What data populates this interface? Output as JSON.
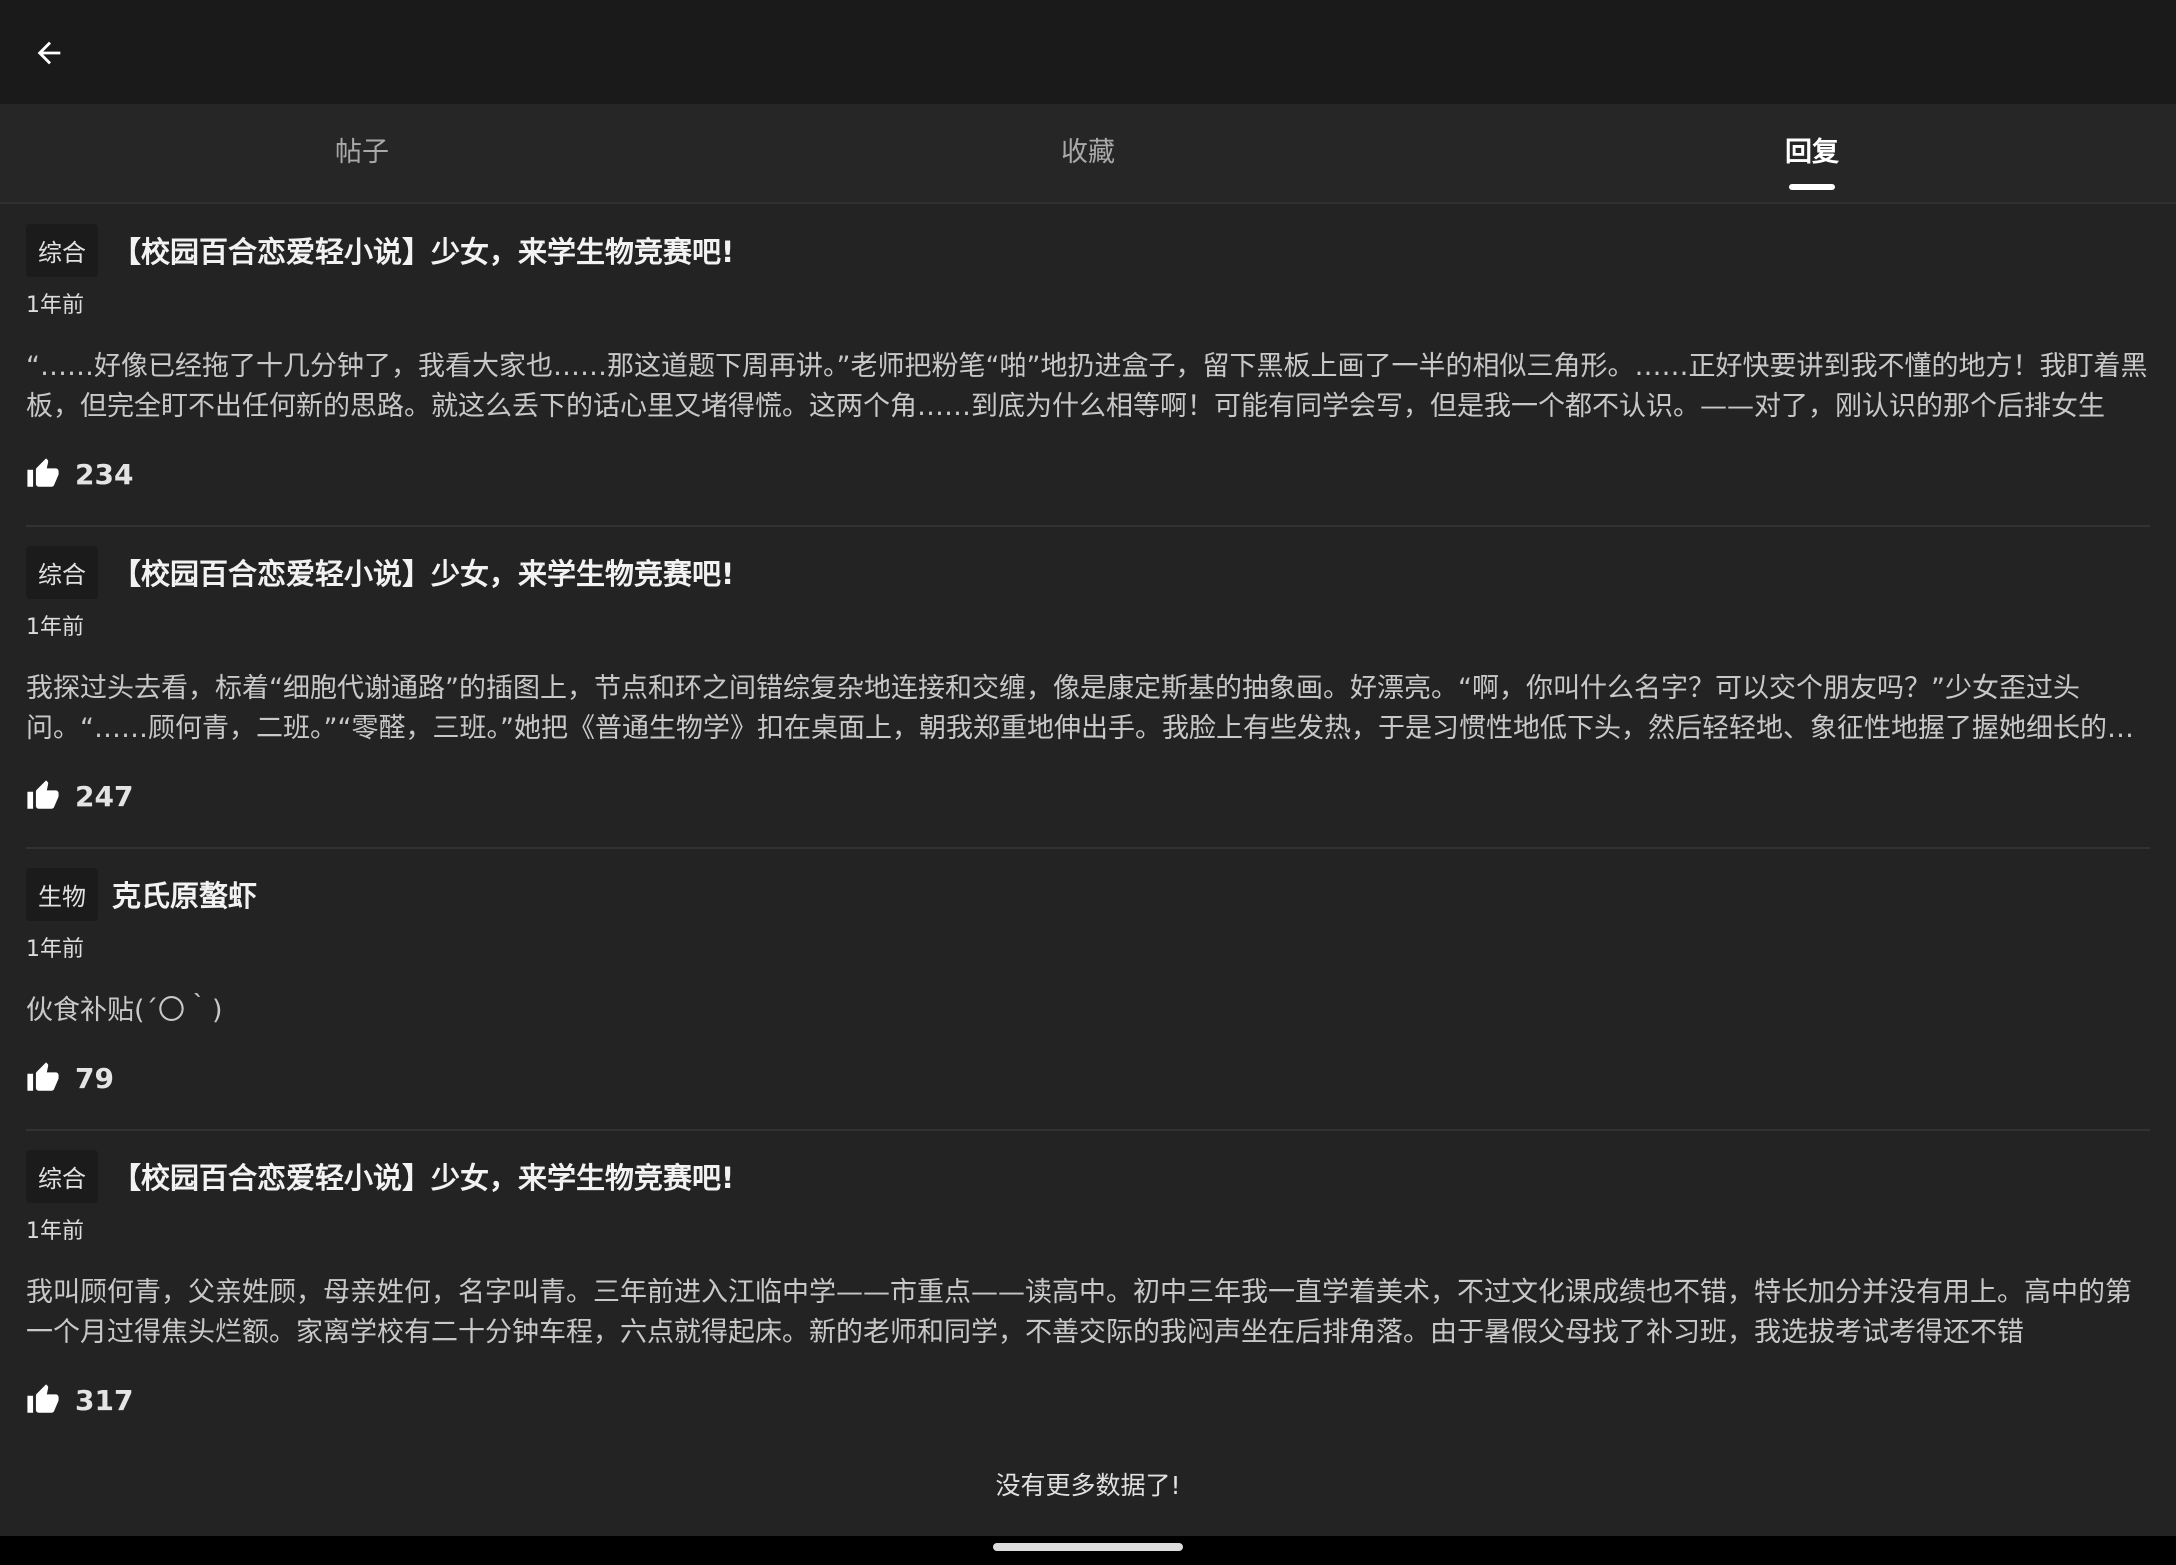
{
  "tabs": [
    {
      "label": "帖子",
      "active": false
    },
    {
      "label": "收藏",
      "active": false
    },
    {
      "label": "回复",
      "active": true
    }
  ],
  "items": [
    {
      "tag": "综合",
      "title": "【校园百合恋爱轻小说】少女，来学生物竞赛吧!",
      "time": "1年前",
      "excerpt": "“……好像已经拖了十几分钟了，我看大家也……那这道题下周再讲。”老师把粉笔“啪”地扔进盒子，留下黑板上画了一半的相似三角形。……正好快要讲到我不懂的地方！我盯着黑板，但完全盯不出任何新的思路。就这么丢下的话心里又堵得慌。这两个角……到底为什么相等啊！可能有同学会写，但是我一个都不认识。——对了，刚认识的那个后排女生",
      "likes": "234"
    },
    {
      "tag": "综合",
      "title": "【校园百合恋爱轻小说】少女，来学生物竞赛吧!",
      "time": "1年前",
      "excerpt": "我探过头去看，标着“细胞代谢通路”的插图上，节点和环之间错综复杂地连接和交缠，像是康定斯基的抽象画。好漂亮。“啊，你叫什么名字？可以交个朋友吗？”少女歪过头问。“……顾何青，二班。”“零醛，三班。”她把《普通生物学》扣在桌面上，朝我郑重地伸出手。我脸上有些发热，于是习惯性地低下头，然后轻轻地、象征性地握了握她细长的手指",
      "likes": "247"
    },
    {
      "tag": "生物",
      "title": "克氏原螯虾",
      "time": "1年前",
      "excerpt": "伙食补贴(´〇｀)",
      "likes": "79"
    },
    {
      "tag": "综合",
      "title": "【校园百合恋爱轻小说】少女，来学生物竞赛吧!",
      "time": "1年前",
      "excerpt": "我叫顾何青，父亲姓顾，母亲姓何，名字叫青。三年前进入江临中学——市重点——读高中。初中三年我一直学着美术，不过文化课成绩也不错，特长加分并没有用上。高中的第一个月过得焦头烂额。家离学校有二十分钟车程，六点就得起床。新的老师和同学，不善交际的我闷声坐在后排角落。由于暑假父母找了补习班，我选拔考试考得还不错",
      "likes": "317"
    }
  ],
  "footer": {
    "message": "没有更多数据了!"
  },
  "icons": {
    "back": "arrow-left-icon",
    "like": "thumbs-up-icon"
  },
  "colors": {
    "topbar": "#1a1a1a",
    "background": "#232323",
    "tag_bg": "#1b1b1b"
  }
}
